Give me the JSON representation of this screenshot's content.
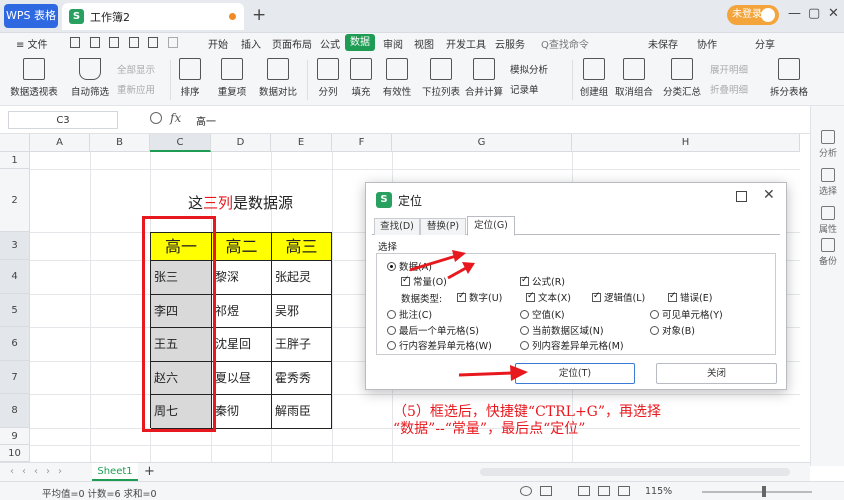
{
  "titlebar": {
    "app_tab": "WPS 表格",
    "doc_tab": "工作簿2",
    "doc_icon_letter": "S",
    "new_tab_symbol": "+",
    "login_label": "未登录",
    "min_symbol": "—",
    "max_symbol": "▢",
    "close_symbol": "✕"
  },
  "menubar": {
    "file": "≡ 文件",
    "items": [
      "开始",
      "插入",
      "页面布局",
      "公式",
      "数据",
      "审阅",
      "视图",
      "开发工具",
      "云服务"
    ],
    "active_item": "数据",
    "search": "Q查找命令",
    "save_status": "未保存",
    "collab": "协作",
    "share": "分享"
  },
  "toolbar": {
    "pivot": "数据透视表",
    "autofilter": "自动筛选",
    "show_all": "全部显示",
    "reapply": "重新应用",
    "sort": "排序",
    "duplicates": "重复项",
    "compare": "数据对比",
    "split": "分列",
    "fill": "填充",
    "validity": "有效性",
    "dropdown": "下拉列表",
    "consolidate": "合并计算",
    "simulate": "模拟分析",
    "record": "记录单",
    "group": "创建组",
    "ungroup": "取消组合",
    "subtotal": "分类汇总",
    "expand": "展开明细",
    "collapse": "折叠明细",
    "split_table": "拆分表格"
  },
  "rightpanel": {
    "items": [
      "分析",
      "选择",
      "属性",
      "备份"
    ]
  },
  "formulabar": {
    "namebox": "C3",
    "fx": "fx",
    "content": "高一"
  },
  "grid": {
    "columns": [
      "A",
      "B",
      "C",
      "D",
      "E",
      "F",
      "G",
      "H"
    ],
    "rows": [
      "1",
      "2",
      "3",
      "4",
      "5",
      "6",
      "7",
      "8",
      "9",
      "10"
    ],
    "title_prefix": "这",
    "title_highlight": "三列",
    "title_suffix": "是数据源",
    "table_headers": [
      "高一",
      "高二",
      "高三"
    ],
    "table_rows": [
      [
        "张三",
        "黎深",
        "张起灵"
      ],
      [
        "李四",
        "祁煜",
        "吴邪"
      ],
      [
        "王五",
        "沈星回",
        "王胖子"
      ],
      [
        "赵六",
        "夏以昼",
        "霍秀秀"
      ],
      [
        "周七",
        "秦彻",
        "解雨臣"
      ]
    ]
  },
  "annotation": {
    "line1": "（5）框选后，快捷键“CTRL+G”，再选择",
    "line2": "“数据”--“常量”，最后点“定位”"
  },
  "dialog": {
    "icon_letter": "S",
    "title": "定位",
    "tabs": [
      "查找(D)",
      "替换(P)",
      "定位(G)"
    ],
    "active_tab": "定位(G)",
    "section": "选择",
    "opt_data": "数据(A)",
    "opt_constant": "常量(O)",
    "opt_formula": "公式(R)",
    "data_type_label": "数据类型:",
    "type_number": "数字(U)",
    "type_text": "文本(X)",
    "type_logical": "逻辑值(L)",
    "type_error": "错误(E)",
    "opt_comment": "批注(C)",
    "opt_blank": "空值(K)",
    "opt_visible": "可见单元格(Y)",
    "opt_last_cell": "最后一个单元格(S)",
    "opt_current_region": "当前数据区域(N)",
    "opt_objects": "对象(B)",
    "opt_row_diff": "行内容差异单元格(W)",
    "opt_col_diff": "列内容差异单元格(M)",
    "btn_locate": "定位(T)",
    "btn_close": "关闭"
  },
  "sheetbar": {
    "sheet": "Sheet1",
    "add": "+"
  },
  "statusbar": {
    "stats": "平均值=0  计数=6  求和=0",
    "zoom": "115%"
  },
  "colors": {
    "accent_green": "#1f9c53",
    "header_yellow": "#ffff00",
    "arrow_red": "#e8191e",
    "login_orange": "#f3a43b"
  }
}
